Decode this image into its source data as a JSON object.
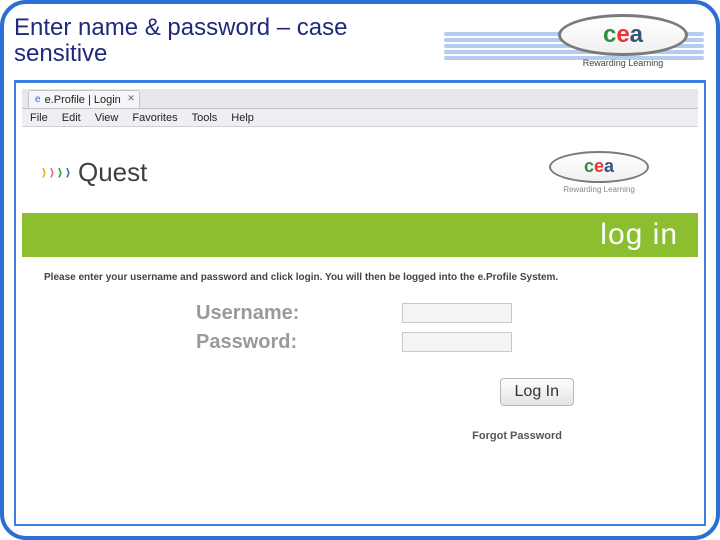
{
  "slide": {
    "title": "Enter name & password – case sensitive"
  },
  "cea": {
    "c": "c",
    "e": "e",
    "a": "a",
    "tagline": "Rewarding Learning"
  },
  "browser": {
    "tab_title": "e.Profile | Login",
    "menu": {
      "file": "File",
      "edit": "Edit",
      "view": "View",
      "favorites": "Favorites",
      "tools": "Tools",
      "help": "Help"
    }
  },
  "page": {
    "quest_brand": "Quest",
    "login_banner": "log in",
    "instructions": "Please enter your username and password and click login. You will then be logged into the e.Profile System.",
    "username_label": "Username:",
    "password_label": "Password:",
    "login_button": "Log In",
    "forgot_link": "Forgot Password"
  },
  "colors": {
    "frame_blue": "#2b6fd4",
    "green_bar": "#8bbf2f"
  }
}
